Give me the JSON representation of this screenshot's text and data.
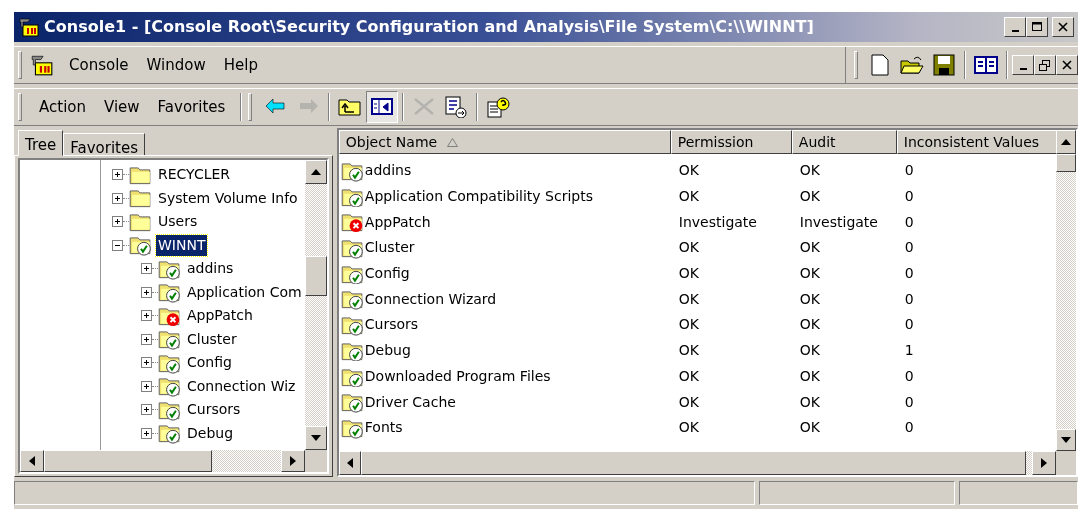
{
  "window": {
    "title": "Console1 - [Console Root\\Security Configuration and Analysis\\File System\\C:\\\\WINNT]"
  },
  "menu": [
    "Console",
    "Window",
    "Help"
  ],
  "action_menu": [
    "Action",
    "View",
    "Favorites"
  ],
  "toolbar_buttons": [
    {
      "kind": "back",
      "disabled": false,
      "pressed": false
    },
    {
      "kind": "forward",
      "disabled": true,
      "pressed": false
    },
    {
      "kind": "up",
      "disabled": false,
      "pressed": false
    },
    {
      "kind": "tree-toggle",
      "disabled": false,
      "pressed": true
    },
    {
      "kind": "delete",
      "disabled": true,
      "pressed": false
    },
    {
      "kind": "export",
      "disabled": false,
      "pressed": false
    },
    {
      "kind": "help",
      "disabled": false,
      "pressed": false
    }
  ],
  "tabs": [
    {
      "label": "Tree",
      "selected": true
    },
    {
      "label": "Favorites",
      "selected": false
    }
  ],
  "tree": [
    {
      "label": "RECYCLER",
      "kind": "folder",
      "expanded": false,
      "selected": false
    },
    {
      "label": "System Volume Info",
      "kind": "folder",
      "expanded": false,
      "selected": false
    },
    {
      "label": "Users",
      "kind": "folder",
      "expanded": false,
      "selected": false
    },
    {
      "label": "WINNT",
      "kind": "folder-ok",
      "expanded": true,
      "selected": true,
      "children": [
        {
          "label": "addins",
          "kind": "folder-ok",
          "expanded": false,
          "selected": false
        },
        {
          "label": "Application Com",
          "kind": "folder-ok",
          "expanded": false,
          "selected": false
        },
        {
          "label": "AppPatch",
          "kind": "folder-error",
          "expanded": false,
          "selected": false
        },
        {
          "label": "Cluster",
          "kind": "folder-ok",
          "expanded": false,
          "selected": false
        },
        {
          "label": "Config",
          "kind": "folder-ok",
          "expanded": false,
          "selected": false
        },
        {
          "label": "Connection Wiz",
          "kind": "folder-ok",
          "expanded": false,
          "selected": false
        },
        {
          "label": "Cursors",
          "kind": "folder-ok",
          "expanded": false,
          "selected": false
        },
        {
          "label": "Debug",
          "kind": "folder-ok",
          "expanded": false,
          "selected": false
        }
      ]
    }
  ],
  "table": {
    "columns": [
      {
        "label": "Object Name",
        "sorted": true
      },
      {
        "label": "Permission",
        "sorted": false
      },
      {
        "label": "Audit",
        "sorted": false
      },
      {
        "label": "Inconsistent Values",
        "sorted": false
      }
    ],
    "rows": [
      {
        "name": "addins",
        "kind": "folder-ok",
        "permission": "OK",
        "audit": "OK",
        "inconsistent": "0"
      },
      {
        "name": "Application Compatibility Scripts",
        "kind": "folder-ok",
        "permission": "OK",
        "audit": "OK",
        "inconsistent": "0"
      },
      {
        "name": "AppPatch",
        "kind": "folder-error",
        "permission": "Investigate",
        "audit": "Investigate",
        "inconsistent": "0"
      },
      {
        "name": "Cluster",
        "kind": "folder-ok",
        "permission": "OK",
        "audit": "OK",
        "inconsistent": "0"
      },
      {
        "name": "Config",
        "kind": "folder-ok",
        "permission": "OK",
        "audit": "OK",
        "inconsistent": "0"
      },
      {
        "name": "Connection Wizard",
        "kind": "folder-ok",
        "permission": "OK",
        "audit": "OK",
        "inconsistent": "0"
      },
      {
        "name": "Cursors",
        "kind": "folder-ok",
        "permission": "OK",
        "audit": "OK",
        "inconsistent": "0"
      },
      {
        "name": "Debug",
        "kind": "folder-ok",
        "permission": "OK",
        "audit": "OK",
        "inconsistent": "1"
      },
      {
        "name": "Downloaded Program Files",
        "kind": "folder-ok",
        "permission": "OK",
        "audit": "OK",
        "inconsistent": "0"
      },
      {
        "name": "Driver Cache",
        "kind": "folder-ok",
        "permission": "OK",
        "audit": "OK",
        "inconsistent": "0"
      },
      {
        "name": "Fonts",
        "kind": "folder-ok",
        "permission": "OK",
        "audit": "OK",
        "inconsistent": "0"
      }
    ]
  }
}
